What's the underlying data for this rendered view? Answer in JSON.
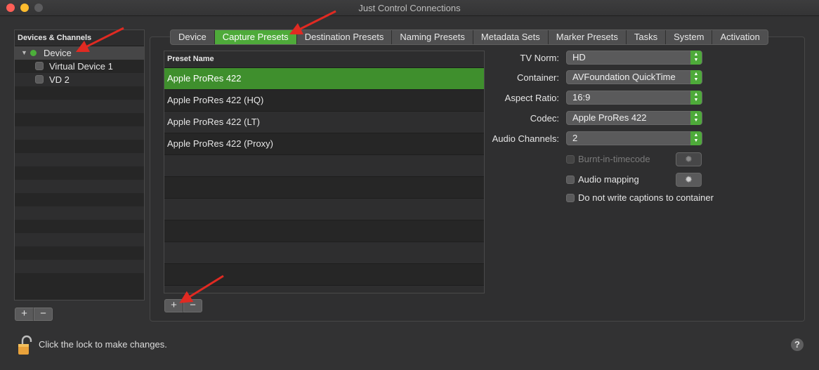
{
  "window": {
    "title": "Just Control Connections"
  },
  "sidebar": {
    "header": "Devices & Channels",
    "device": {
      "label": "Device",
      "status_color": "#4caf3a"
    },
    "channels": [
      {
        "label": "Virtual Device 1",
        "checked": false
      },
      {
        "label": "VD 2",
        "checked": false
      }
    ],
    "add_label": "+",
    "remove_label": "−"
  },
  "tabs": [
    {
      "label": "Device",
      "active": false
    },
    {
      "label": "Capture Presets",
      "active": true
    },
    {
      "label": "Destination Presets",
      "active": false
    },
    {
      "label": "Naming Presets",
      "active": false
    },
    {
      "label": "Metadata Sets",
      "active": false
    },
    {
      "label": "Marker Presets",
      "active": false
    },
    {
      "label": "Tasks",
      "active": false
    },
    {
      "label": "System",
      "active": false
    },
    {
      "label": "Activation",
      "active": false
    }
  ],
  "presets": {
    "header": "Preset Name",
    "items": [
      {
        "label": "Apple ProRes 422",
        "selected": true
      },
      {
        "label": "Apple ProRes 422 (HQ)",
        "selected": false
      },
      {
        "label": "Apple ProRes 422 (LT)",
        "selected": false
      },
      {
        "label": "Apple ProRes 422 (Proxy)",
        "selected": false
      }
    ],
    "add_label": "+",
    "remove_label": "−"
  },
  "form": {
    "tv_norm": {
      "label": "TV Norm:",
      "value": "HD"
    },
    "container": {
      "label": "Container:",
      "value": "AVFoundation QuickTime"
    },
    "aspect_ratio": {
      "label": "Aspect Ratio:",
      "value": "16:9"
    },
    "codec": {
      "label": "Codec:",
      "value": "Apple ProRes 422"
    },
    "audio_channels": {
      "label": "Audio Channels:",
      "value": "2"
    },
    "burnin": {
      "label": "Burnt-in-timecode",
      "checked": false,
      "enabled": false
    },
    "audio_mapping": {
      "label": "Audio mapping",
      "checked": false,
      "enabled": true
    },
    "no_captions": {
      "label": "Do not write captions to container",
      "checked": false,
      "enabled": true
    }
  },
  "footer": {
    "lock_text": "Click the lock to make changes.",
    "help_label": "?"
  },
  "colors": {
    "accent": "#4eaa3a",
    "selection": "#3f8f2d",
    "arrow": "#e02a22"
  }
}
